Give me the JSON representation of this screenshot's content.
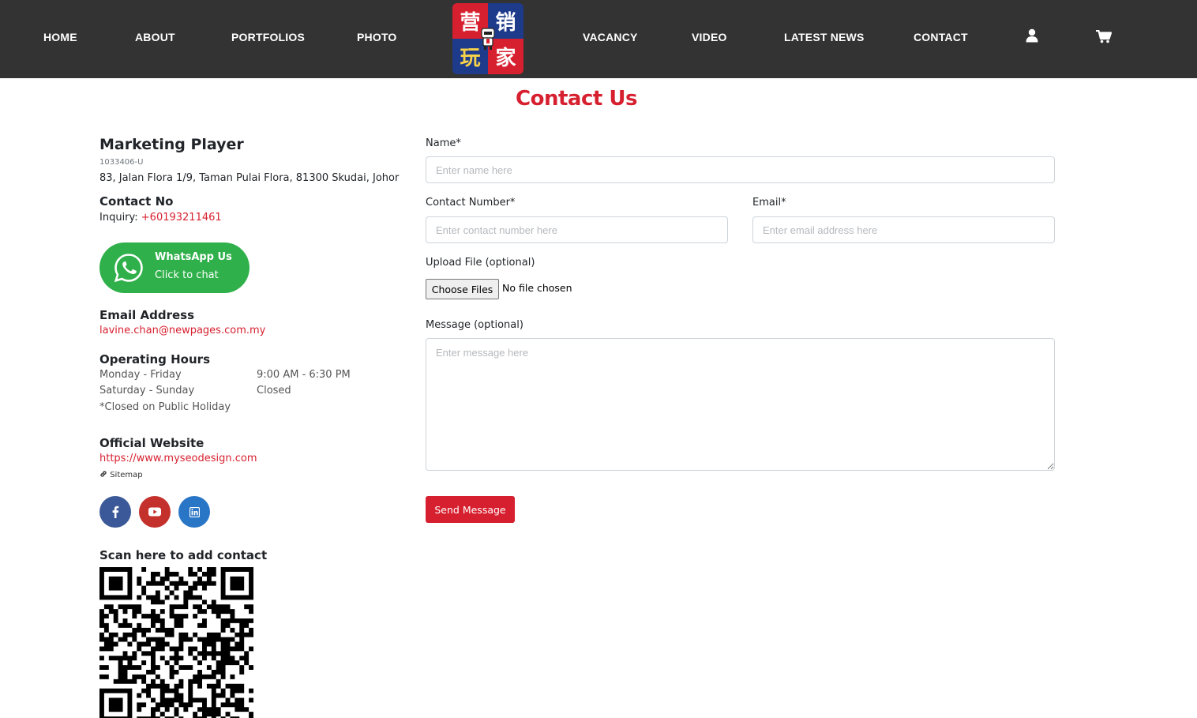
{
  "nav": {
    "items": [
      {
        "label": "HOME"
      },
      {
        "label": "ABOUT"
      },
      {
        "label": "PORTFOLIOS"
      },
      {
        "label": "PHOTO"
      },
      {
        "label": "VACANCY"
      },
      {
        "label": "VIDEO"
      },
      {
        "label": "LATEST NEWS"
      },
      {
        "label": "CONTACT"
      }
    ],
    "logo_chars": [
      "营",
      "销",
      "玩",
      "家"
    ],
    "user_icon": "user-icon",
    "cart_icon": "cart-icon"
  },
  "page": {
    "title": "Contact Us"
  },
  "company": {
    "name": "Marketing Player",
    "reg_no": "1033406-U",
    "address": "83, Jalan Flora 1/9, Taman Pulai Flora, 81300 Skudai, Johor",
    "contact_heading": "Contact No",
    "inquiry_label": "Inquiry: ",
    "phone": "+60193211461",
    "whatsapp_title": "WhatsApp Us",
    "whatsapp_sub": "Click to chat",
    "email_heading": "Email Address",
    "email": "lavine.chan@newpages.com.my",
    "hours_heading": "Operating Hours",
    "hours": [
      {
        "days": "Monday - Friday",
        "time": "9:00 AM - 6:30 PM"
      },
      {
        "days": "Saturday - Sunday",
        "time": "Closed"
      }
    ],
    "hours_note": "*Closed on Public Holiday",
    "website_heading": "Official Website",
    "website": "https://www.myseodesign.com",
    "sitemap": "Sitemap",
    "social": [
      "facebook-icon",
      "youtube-icon",
      "linkedin-icon"
    ],
    "qr_heading": "Scan here to add contact"
  },
  "form": {
    "name_label": "Name*",
    "name_placeholder": "Enter name here",
    "contact_label": "Contact Number*",
    "contact_placeholder": "Enter contact number here",
    "email_label": "Email*",
    "email_placeholder": "Enter email address here",
    "upload_label": "Upload File (optional)",
    "file_button": "Choose Files",
    "file_status": "No file chosen",
    "message_label": "Message (optional)",
    "message_placeholder": "Enter message here",
    "send_label": "Send Message"
  },
  "colors": {
    "accent": "#d7202f",
    "navbar": "#333333",
    "whatsapp": "#2fb04a"
  }
}
